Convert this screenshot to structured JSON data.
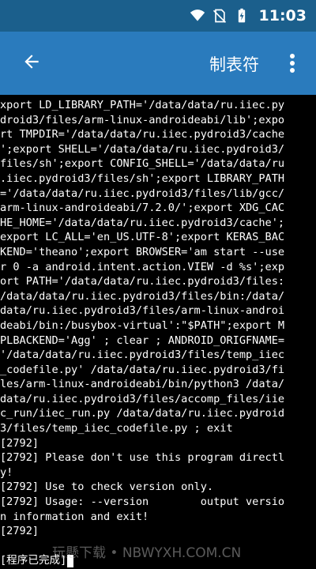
{
  "status_bar": {
    "time": "11:03",
    "icons": [
      "wifi-icon",
      "no-sim-icon",
      "battery-charging-icon"
    ]
  },
  "app_bar": {
    "title": "制表符",
    "back_icon": "arrow-back-icon",
    "menu_icon": "more-vert-icon"
  },
  "terminal": {
    "lines": [
      "xport LD_LIBRARY_PATH='/data/data/ru.iiec.py",
      "droid3/files/arm-linux-androideabi/lib';expo",
      "rt TMPDIR='/data/data/ru.iiec.pydroid3/cache",
      "';export SHELL='/data/data/ru.iiec.pydroid3/",
      "files/sh';export CONFIG_SHELL='/data/data/ru",
      ".iiec.pydroid3/files/sh';export LIBRARY_PATH",
      "='/data/data/ru.iiec.pydroid3/files/lib/gcc/",
      "arm-linux-androideabi/7.2.0/';export XDG_CAC",
      "HE_HOME='/data/data/ru.iiec.pydroid3/cache';",
      "export LC_ALL='en_US.UTF-8';export KERAS_BAC",
      "KEND='theano';export BROWSER='am start --use",
      "r 0 -a android.intent.action.VIEW -d %s';exp",
      "ort PATH='/data/data/ru.iiec.pydroid3/files:",
      "/data/data/ru.iiec.pydroid3/files/bin:/data/",
      "data/ru.iiec.pydroid3/files/arm-linux-androi",
      "deabi/bin:/busybox-virtual':\"$PATH\";export M",
      "PLBACKEND='Agg' ; clear ; ANDROID_ORIGFNAME=",
      "'/data/data/ru.iiec.pydroid3/files/temp_iiec",
      "_codefile.py' /data/data/ru.iiec.pydroid3/fi",
      "les/arm-linux-androideabi/bin/python3 /data/",
      "data/ru.iiec.pydroid3/files/accomp_files/iie",
      "c_run/iiec_run.py /data/data/ru.iiec.pydroid",
      "3/files/temp_iiec_codefile.py ; exit",
      "[2792]",
      "[2792] Please don't use this program directl",
      "y!",
      "[2792] Use to check version only.",
      "[2792] Usage: --version        output versio",
      "n information and exit!",
      "[2792]"
    ],
    "final_line": "[程序已完成]"
  },
  "watermark": "玩懸下载 • NBWYXH.COM.CN"
}
